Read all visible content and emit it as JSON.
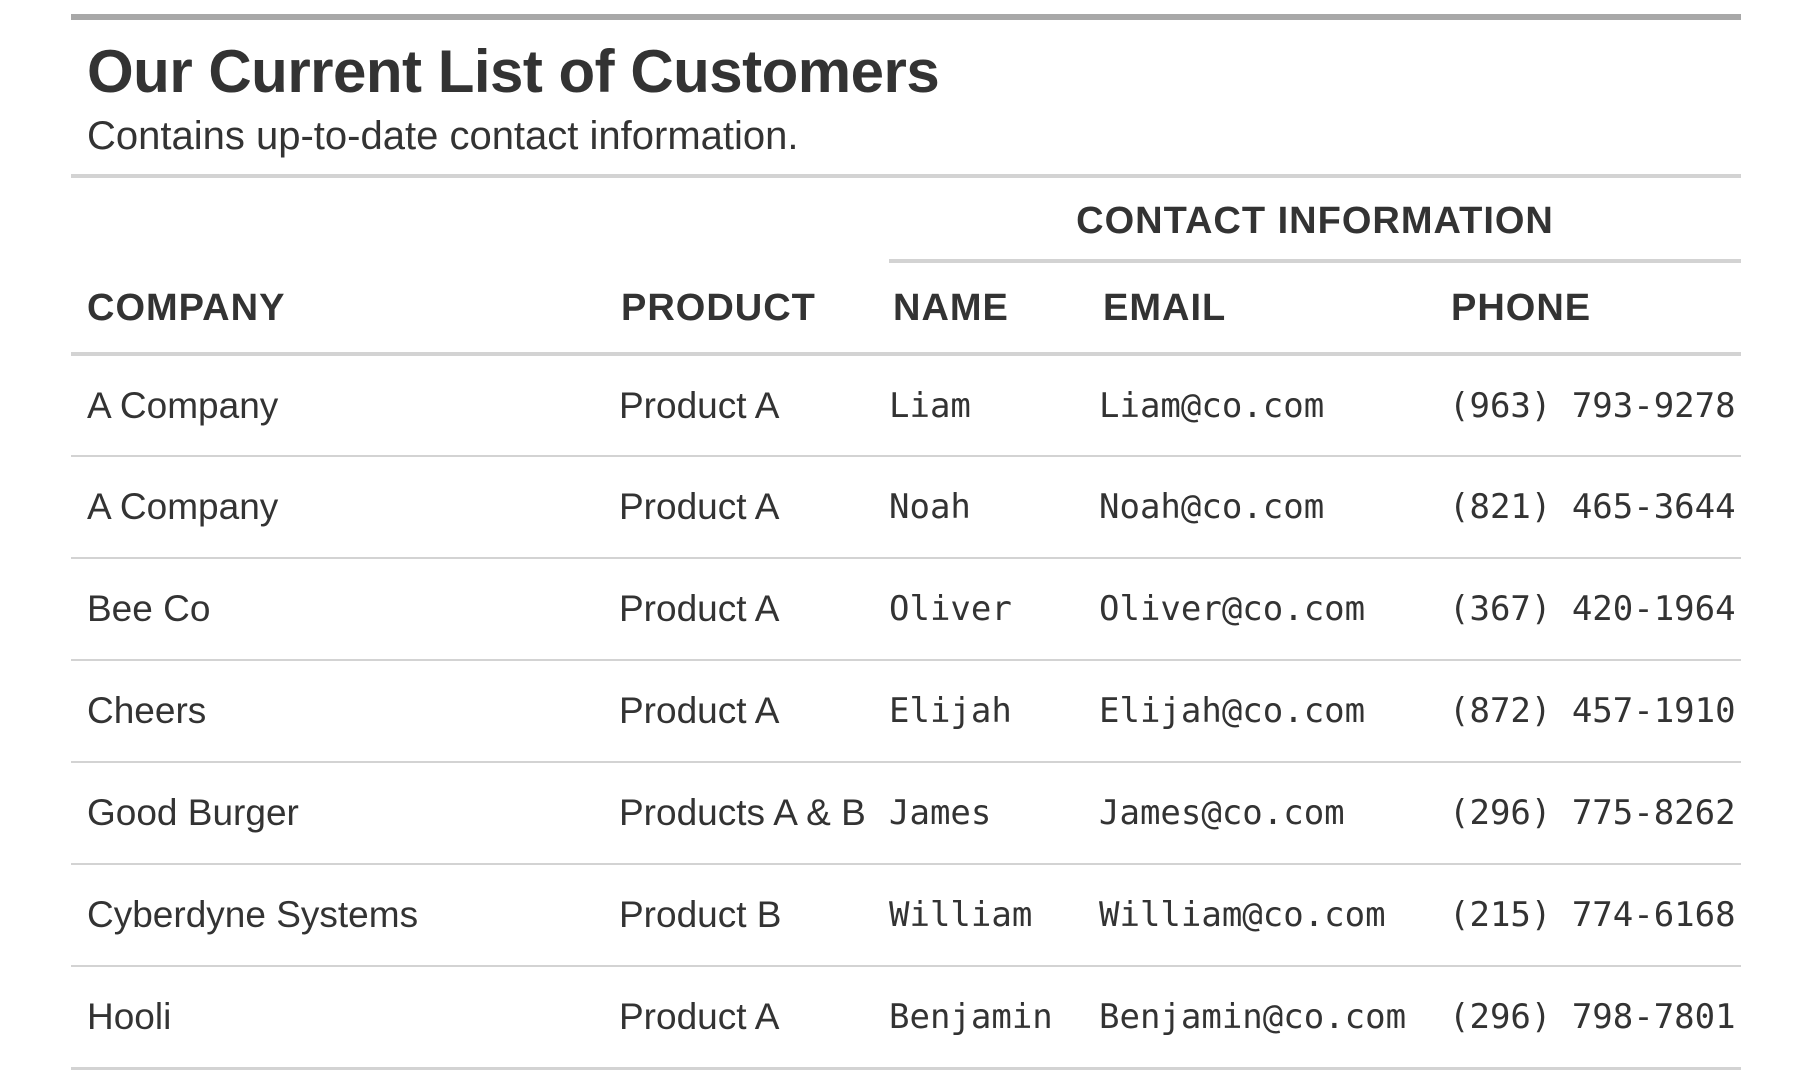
{
  "header": {
    "title": "Our Current List of Customers",
    "subtitle": "Contains up-to-date contact information."
  },
  "spanner": {
    "label": "CONTACT INFORMATION"
  },
  "columns": {
    "company": "COMPANY",
    "product": "PRODUCT",
    "name": "NAME",
    "email": "EMAIL",
    "phone": "PHONE"
  },
  "rows": [
    {
      "company": "A Company",
      "product": "Product A",
      "name": "Liam",
      "email": "Liam@co.com",
      "phone": "(963) 793-9278"
    },
    {
      "company": "A Company",
      "product": "Product A",
      "name": "Noah",
      "email": "Noah@co.com",
      "phone": "(821) 465-3644"
    },
    {
      "company": "Bee Co",
      "product": "Product A",
      "name": "Oliver",
      "email": "Oliver@co.com",
      "phone": "(367) 420-1964"
    },
    {
      "company": "Cheers",
      "product": "Product A",
      "name": "Elijah",
      "email": "Elijah@co.com",
      "phone": "(872) 457-1910"
    },
    {
      "company": "Good Burger",
      "product": "Products A & B",
      "name": "James",
      "email": "James@co.com",
      "phone": "(296) 775-8262"
    },
    {
      "company": "Cyberdyne Systems",
      "product": "Product B",
      "name": "William",
      "email": "William@co.com",
      "phone": "(215) 774-6168"
    },
    {
      "company": "Hooli",
      "product": "Product A",
      "name": "Benjamin",
      "email": "Benjamin@co.com",
      "phone": "(296) 798-7801"
    }
  ],
  "colors": {
    "text": "#333333",
    "top_rule": "#a8a8a8",
    "rule": "#d3d3d3"
  }
}
